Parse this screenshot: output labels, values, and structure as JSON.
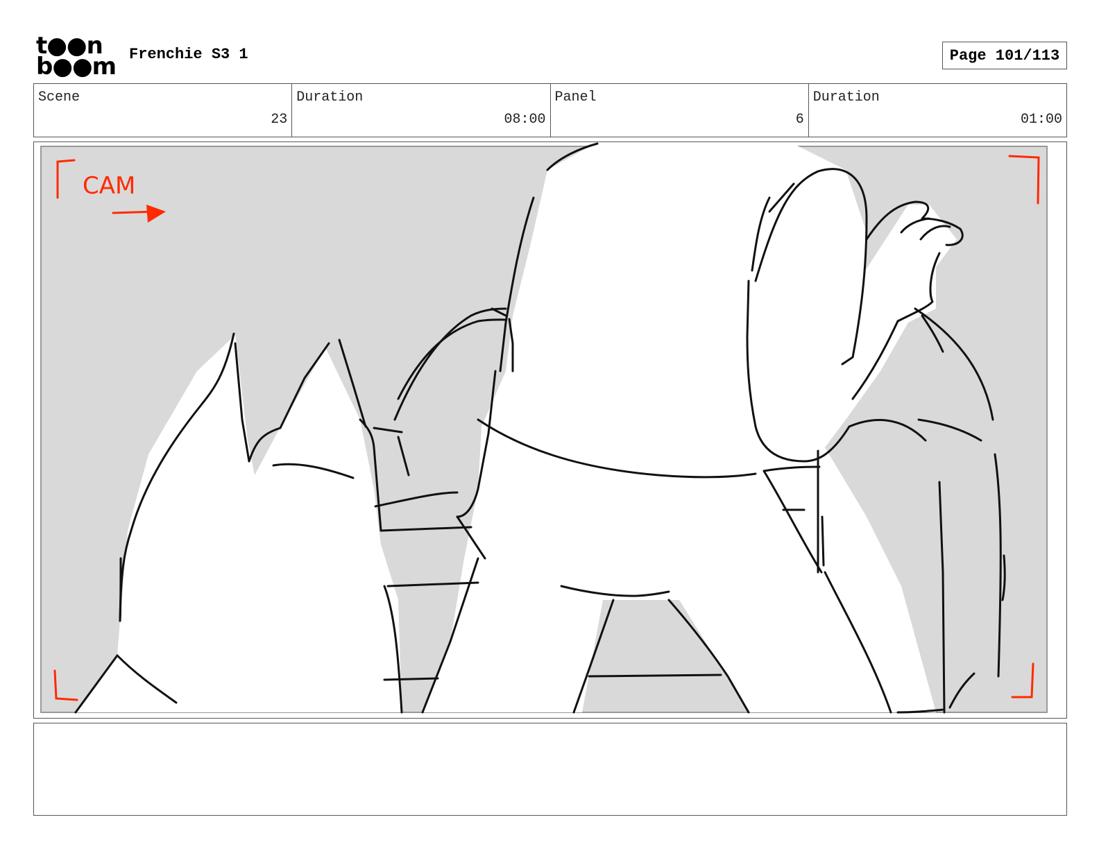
{
  "logo": {
    "line1": "t●●n",
    "line2": "b●●m"
  },
  "header": {
    "project_title": "Frenchie S3 1",
    "page_label": "Page 101/113"
  },
  "info": [
    {
      "label": "Scene",
      "value": "23"
    },
    {
      "label": "Duration",
      "value": "08:00"
    },
    {
      "label": "Panel",
      "value": "6"
    },
    {
      "label": "Duration",
      "value": "01:00"
    }
  ],
  "panel": {
    "cam_label": "CAM",
    "annotation_color": "#ff2a00",
    "background_color": "#d9d9d9"
  },
  "caption": {
    "text": ""
  }
}
